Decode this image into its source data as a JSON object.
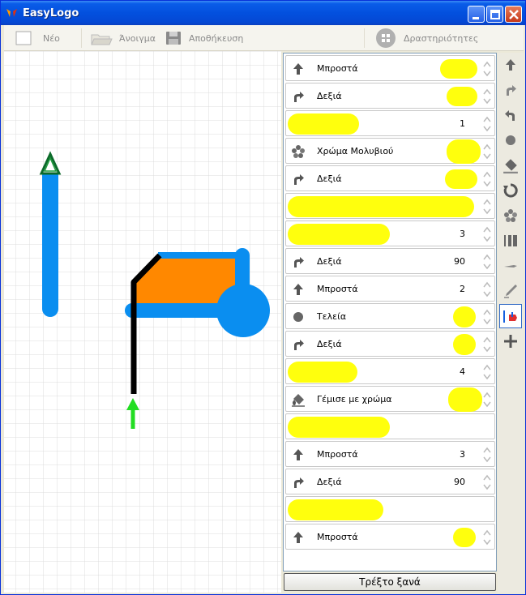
{
  "window": {
    "title": "EasyLogo"
  },
  "toolbar": {
    "new_label": "Νέο",
    "open_label": "Άνοιγμα",
    "save_label": "Αποθήκευση",
    "activities_label": "Δραστηριότητες"
  },
  "program": {
    "rows": [
      {
        "label": "Μπροστά",
        "value": ""
      },
      {
        "label": "Δεξιά",
        "value": ""
      },
      {
        "label": "",
        "value": "1"
      },
      {
        "label": "Χρώμα Μολυβιού",
        "value": ""
      },
      {
        "label": "Δεξιά",
        "value": ""
      },
      {
        "label": "",
        "value": ""
      },
      {
        "label": "",
        "value": "3"
      },
      {
        "label": "Δεξιά",
        "value": "90"
      },
      {
        "label": "Μπροστά",
        "value": "2"
      },
      {
        "label": "Τελεία",
        "value": ""
      },
      {
        "label": "Δεξιά",
        "value": ""
      },
      {
        "label": "",
        "value": "4"
      },
      {
        "label": "Γέμισε με χρώμα",
        "value": ""
      },
      {
        "label": "",
        "value": ""
      },
      {
        "label": "Μπροστά",
        "value": "3"
      },
      {
        "label": "Δεξιά",
        "value": "90"
      },
      {
        "label": "",
        "value": ""
      },
      {
        "label": "Μπροστά",
        "value": ""
      }
    ]
  },
  "run_button": {
    "label": "Τρέξτο ξανά"
  },
  "colors": {
    "highlight": "#ffff00",
    "pen_blue": "#0a8ef0",
    "fill_orange": "#ff8800",
    "turtle_green": "#22cc22",
    "title_blue": "#0350de"
  }
}
